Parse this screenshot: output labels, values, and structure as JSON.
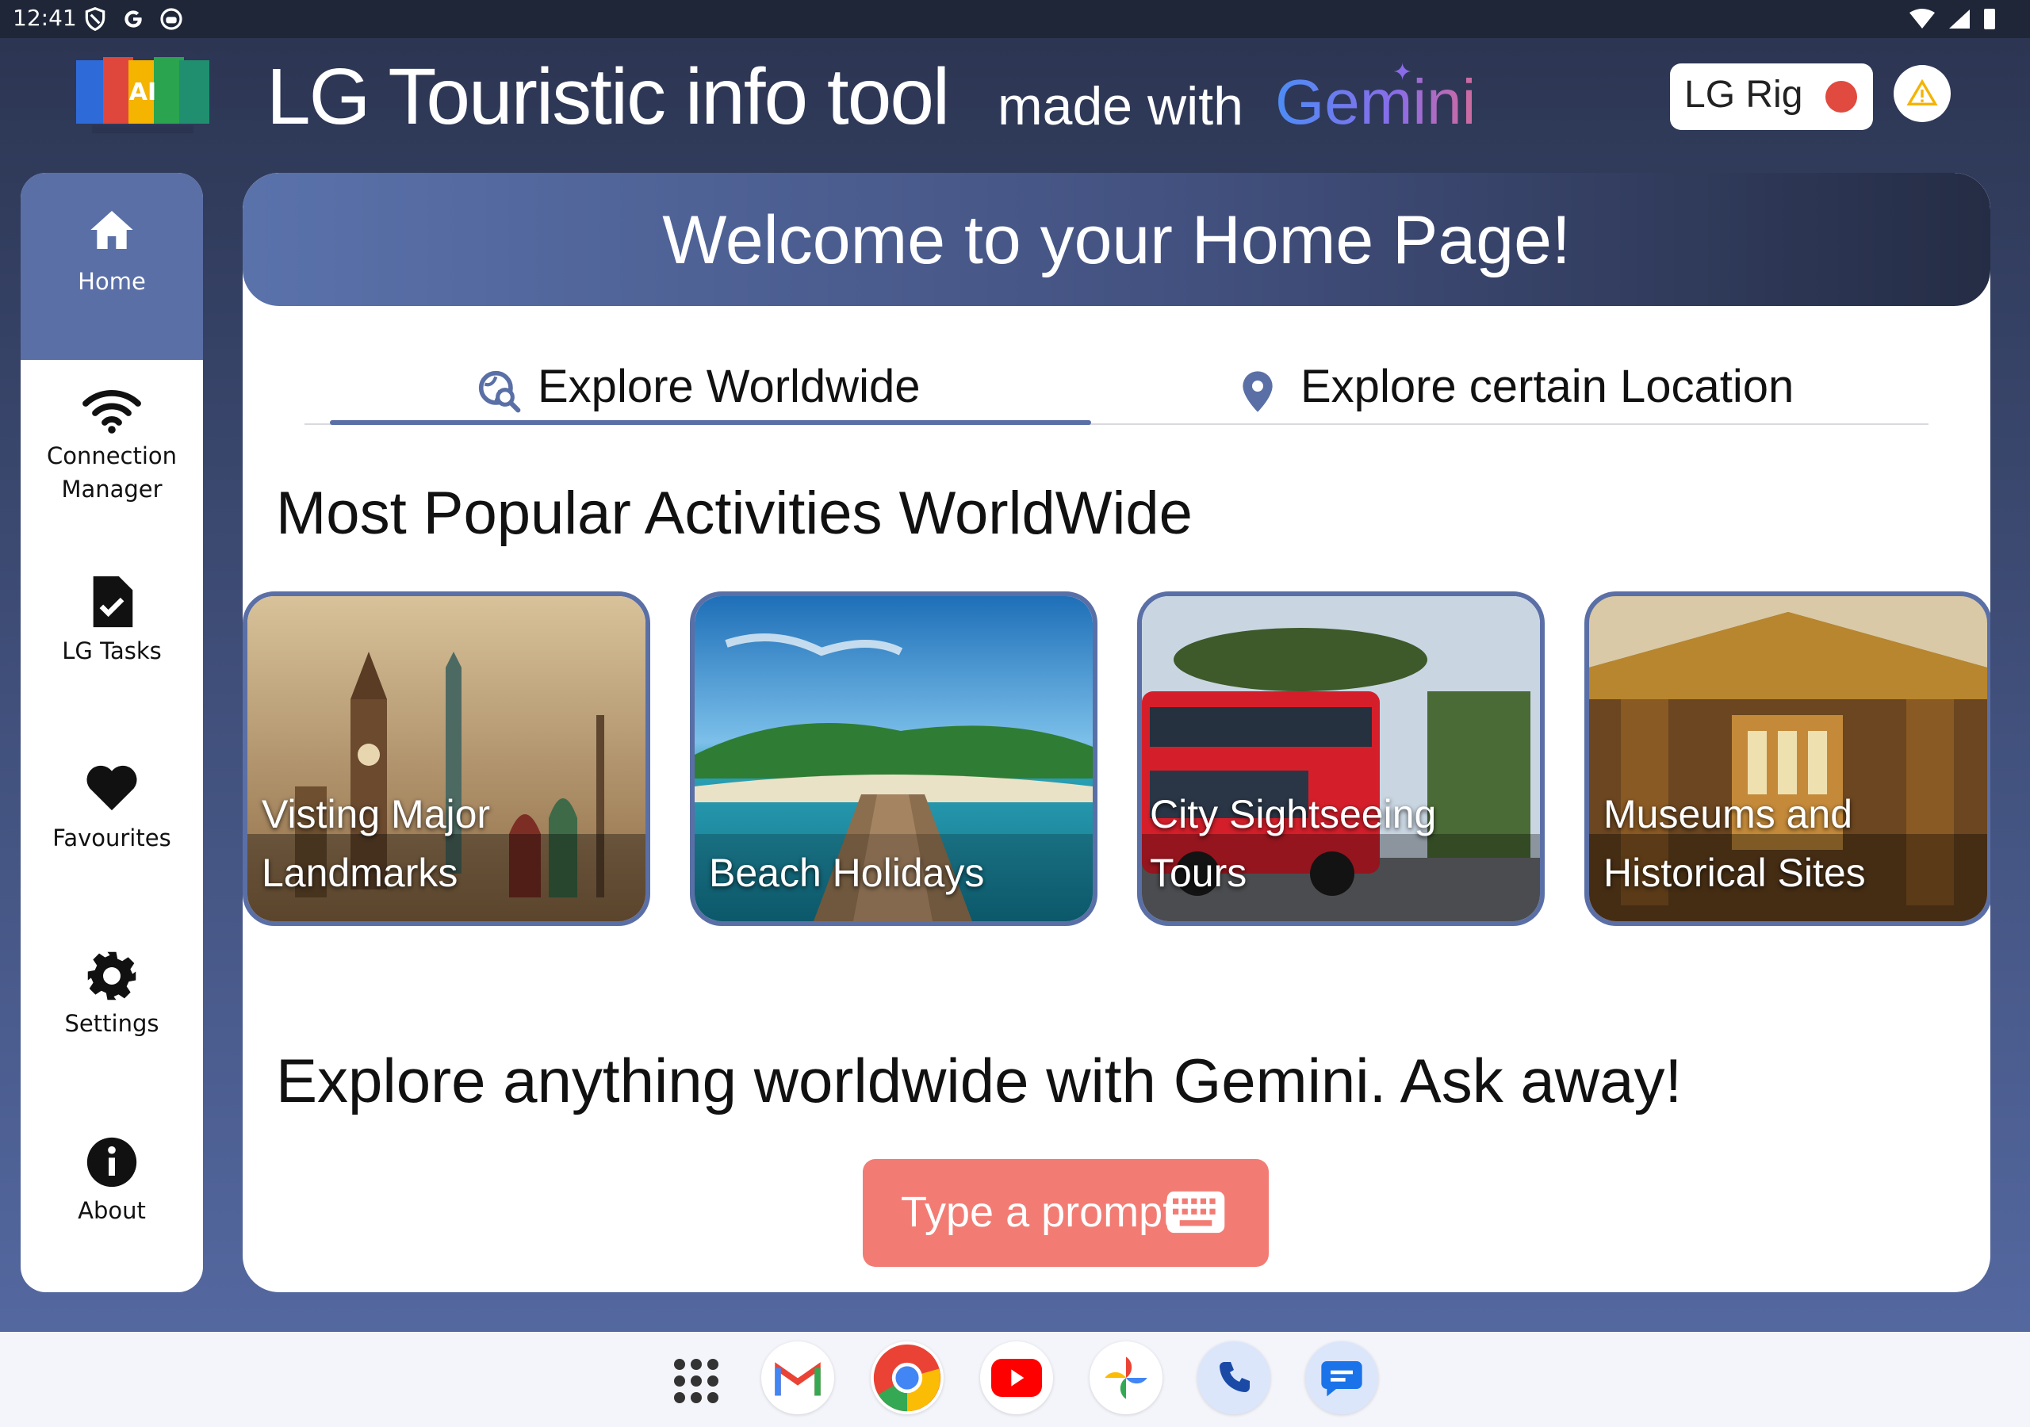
{
  "status_bar": {
    "time": "12:41",
    "left_icons": [
      "shield-icon",
      "google-g-icon",
      "android-icon"
    ],
    "right_icons": [
      "wifi-icon",
      "cell-signal-icon",
      "battery-icon"
    ]
  },
  "header": {
    "title": "LG Touristic info tool",
    "subtitle": "made with",
    "brand": "Gemini",
    "rig_label": "LG Rig",
    "rig_status_color": "#e04a3f",
    "warning_icon": "warning-triangle-icon"
  },
  "sidebar": {
    "items": [
      {
        "label": "Home",
        "icon": "home-icon",
        "active": true
      },
      {
        "label": "Connection Manager",
        "icon": "wifi-icon"
      },
      {
        "label": "LG Tasks",
        "icon": "task-file-icon"
      },
      {
        "label": "Favourites",
        "icon": "heart-icon"
      },
      {
        "label": "Settings",
        "icon": "gear-icon"
      },
      {
        "label": "About",
        "icon": "info-icon"
      }
    ]
  },
  "main": {
    "welcome": "Welcome to your Home Page!",
    "tabs": [
      {
        "label": "Explore Worldwide",
        "icon": "globe-search-icon",
        "selected": true
      },
      {
        "label": "Explore certain Location",
        "icon": "location-pin-icon",
        "selected": false
      }
    ],
    "section_title": "Most Popular Activities WorldWide",
    "cards": [
      {
        "line1": "Visting Major",
        "line2": "Landmarks"
      },
      {
        "line1": "",
        "line2": "Beach Holidays"
      },
      {
        "line1": "City Sightseeing",
        "line2": "Tours"
      },
      {
        "line1": "Museums and",
        "line2": "Historical Sites"
      }
    ],
    "ask_title": "Explore anything worldwide with Gemini. Ask away!",
    "prompt_button": "Type a prompt",
    "prompt_icon": "keyboard-icon"
  },
  "taskbar": {
    "apps": [
      "app-drawer-icon",
      "gmail-icon",
      "chrome-icon",
      "youtube-icon",
      "photos-icon",
      "phone-icon",
      "messages-icon"
    ]
  },
  "colors": {
    "accent": "#5a6fa6",
    "prompt_button": "#f27c74",
    "banner_dark": "#252d45"
  }
}
